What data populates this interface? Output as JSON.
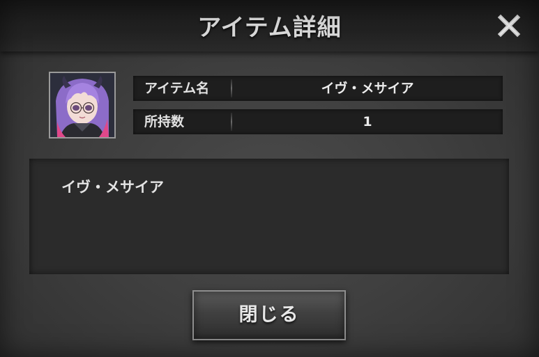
{
  "dialog": {
    "title": "アイテム詳細",
    "close_icon": "close-icon"
  },
  "item": {
    "portrait_icon": "character-portrait",
    "rows": [
      {
        "label": "アイテム名",
        "value": "イヴ・メサイア"
      },
      {
        "label": "所持数",
        "value": "1"
      }
    ],
    "description": "イヴ・メサイア"
  },
  "footer": {
    "close_button_label": "閉じる"
  },
  "colors": {
    "panel": "#3f3f3f",
    "title_bar": "#1e1e1e",
    "row_bg": "#1e1e1e",
    "text": "#e4e4e4",
    "hair_accent": "#9b7ad6",
    "outfit_accent": "#e0488a"
  }
}
